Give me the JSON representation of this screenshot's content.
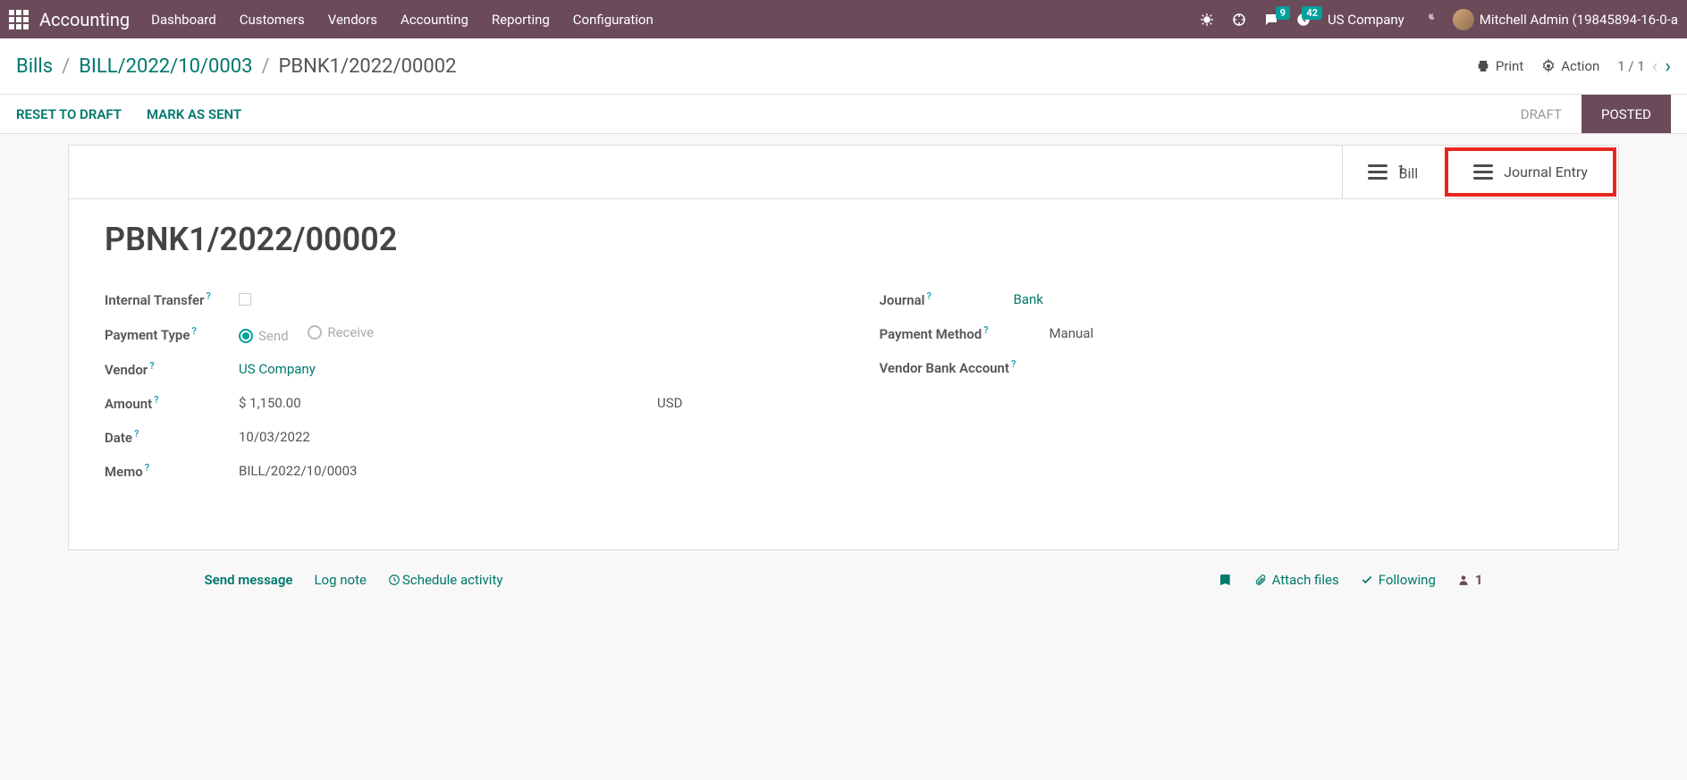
{
  "topbar": {
    "app_title": "Accounting",
    "nav": [
      "Dashboard",
      "Customers",
      "Vendors",
      "Accounting",
      "Reporting",
      "Configuration"
    ],
    "msg_badge": "9",
    "clock_badge": "42",
    "company": "US Company",
    "user": "Mitchell Admin (19845894-16-0-a"
  },
  "crumbs": {
    "bills": "Bills",
    "bill_ref": "BILL/2022/10/0003",
    "current": "PBNK1/2022/00002"
  },
  "controls": {
    "print": "Print",
    "action": "Action",
    "pager": "1 / 1"
  },
  "statusbar": {
    "reset": "RESET TO DRAFT",
    "mark_sent": "MARK AS SENT",
    "draft": "DRAFT",
    "posted": "POSTED"
  },
  "stat_buttons": {
    "bill_count": "1",
    "bill_label": "Bill",
    "journal_label": "Journal Entry"
  },
  "record_title": "PBNK1/2022/00002",
  "fields": {
    "internal_transfer_label": "Internal Transfer",
    "payment_type_label": "Payment Type",
    "payment_send": "Send",
    "payment_receive": "Receive",
    "vendor_label": "Vendor",
    "vendor_value": "US Company",
    "amount_label": "Amount",
    "amount_value": "$ 1,150.00",
    "amount_currency": "USD",
    "date_label": "Date",
    "date_value": "10/03/2022",
    "memo_label": "Memo",
    "memo_value": "BILL/2022/10/0003",
    "journal_label": "Journal",
    "journal_value": "Bank",
    "payment_method_label": "Payment Method",
    "payment_method_value": "Manual",
    "vendor_bank_label": "Vendor Bank Account"
  },
  "chatter": {
    "send": "Send message",
    "log": "Log note",
    "schedule": "Schedule activity",
    "attach": "Attach files",
    "following": "Following",
    "followers": "1"
  }
}
